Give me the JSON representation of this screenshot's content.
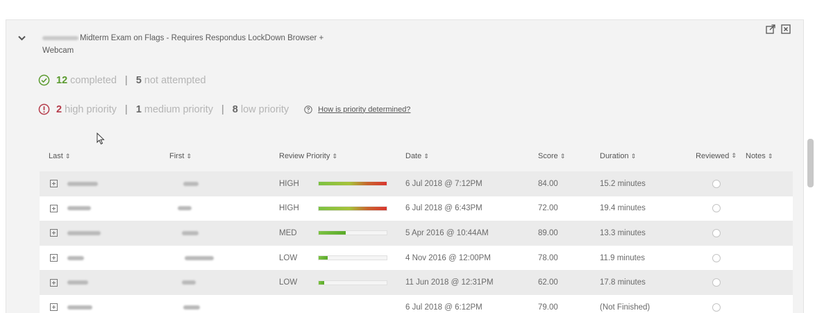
{
  "exam": {
    "title": "Midterm Exam on Flags - Requires Respondus LockDown Browser +",
    "title_line2": "Webcam"
  },
  "icons": {
    "collapse": "chevron-down-icon",
    "popout": "external-link-icon",
    "close": "close-box-icon",
    "completed": "check-circle-icon",
    "priority": "exclamation-circle-icon",
    "help": "question-circle-icon",
    "expand_row": "plus-box-icon"
  },
  "completion": {
    "completed_count": "12",
    "completed_label": "completed",
    "separator": "|",
    "not_attempted_count": "5",
    "not_attempted_label": "not attempted"
  },
  "priority_summary": {
    "high_count": "2",
    "high_label": "high priority",
    "separator": "|",
    "medium_count": "1",
    "medium_label": "medium priority",
    "low_count": "8",
    "low_label": "low priority",
    "help_link": "How is priority determined?"
  },
  "table": {
    "headers": {
      "last": "Last",
      "first": "First",
      "priority": "Review Priority",
      "date": "Date",
      "score": "Score",
      "duration": "Duration",
      "reviewed": "Reviewed",
      "notes": "Notes",
      "sort_icon": "⇕"
    },
    "rows": [
      {
        "priority": "HIGH",
        "priority_level": 1.0,
        "date": "6 Jul 2018 @ 7:12PM",
        "score": "84.00",
        "duration": "15.2 minutes"
      },
      {
        "priority": "HIGH",
        "priority_level": 1.0,
        "date": "6 Jul 2018 @ 6:43PM",
        "score": "72.00",
        "duration": "19.4 minutes"
      },
      {
        "priority": "MED",
        "priority_level": 0.4,
        "date": "5 Apr 2016 @ 10:44AM",
        "score": "89.00",
        "duration": "13.3 minutes"
      },
      {
        "priority": "LOW",
        "priority_level": 0.13,
        "date": "4 Nov 2016 @ 12:00PM",
        "score": "78.00",
        "duration": "11.9 minutes"
      },
      {
        "priority": "LOW",
        "priority_level": 0.08,
        "date": "11 Jun 2018 @ 12:31PM",
        "score": "62.00",
        "duration": "17.8 minutes"
      },
      {
        "priority": "",
        "priority_level": 0,
        "date": "6 Jul 2018 @ 6:12PM",
        "score": "79.00",
        "duration": "(Not Finished)"
      }
    ]
  },
  "colors": {
    "completed_green": "#5a9a2e",
    "priority_red": "#b53b4a",
    "bar_green": "#7cc243",
    "bar_red": "#d9362f"
  }
}
